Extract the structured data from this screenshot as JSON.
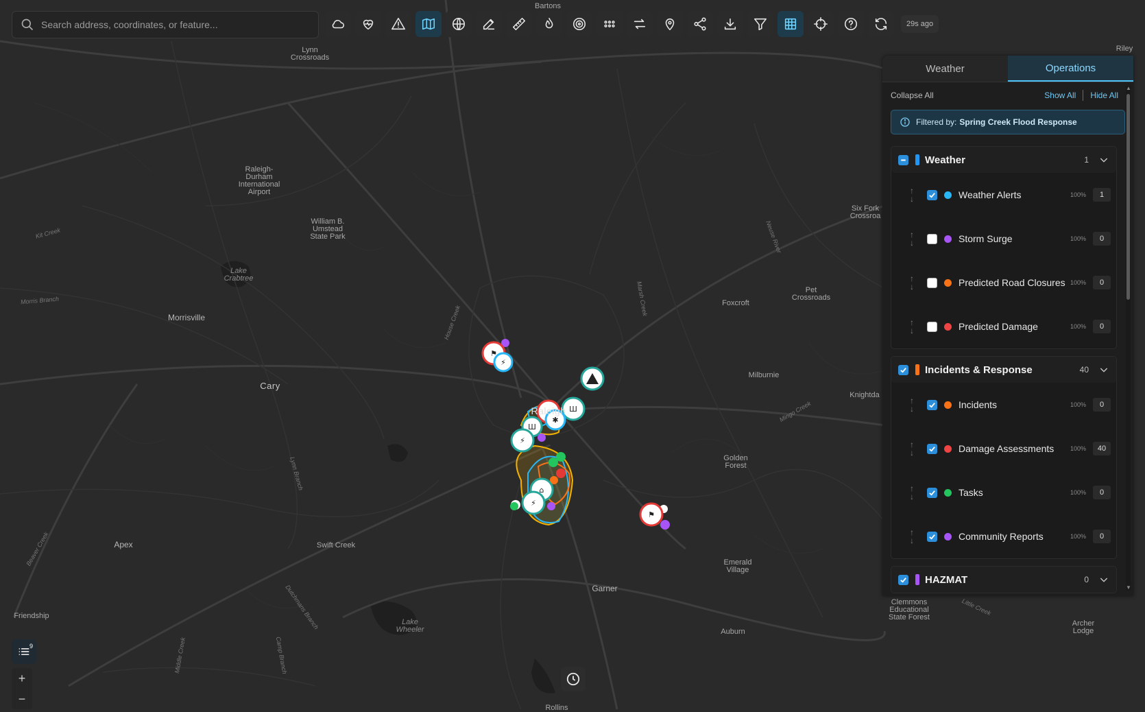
{
  "search": {
    "placeholder": "Search address, coordinates, or feature..."
  },
  "toolbar": {
    "buttons": [
      {
        "name": "cloud-icon",
        "active": false
      },
      {
        "name": "heart-pulse-icon",
        "active": false
      },
      {
        "name": "warning-icon",
        "active": false
      },
      {
        "name": "map-icon",
        "active": true
      },
      {
        "name": "globe-icon",
        "active": false
      },
      {
        "name": "edit-icon",
        "active": false
      },
      {
        "name": "ruler-icon",
        "active": false
      },
      {
        "name": "fire-icon",
        "active": false
      },
      {
        "name": "target-icon",
        "active": false
      },
      {
        "name": "grid-dots-icon",
        "active": false
      },
      {
        "name": "swap-icon",
        "active": false
      },
      {
        "name": "location-pin-icon",
        "active": false
      },
      {
        "name": "share-icon",
        "active": false
      },
      {
        "name": "download-icon",
        "active": false
      },
      {
        "name": "filter-icon",
        "active": false
      },
      {
        "name": "table-icon",
        "active": true
      },
      {
        "name": "crosshair-icon",
        "active": false
      },
      {
        "name": "help-icon",
        "active": false
      },
      {
        "name": "refresh-icon",
        "active": false
      }
    ],
    "updated": "29s ago"
  },
  "places": [
    {
      "name": "Bartons",
      "cls": "place"
    },
    {
      "name": "Lynn\nCrossroads",
      "cls": "place"
    },
    {
      "name": "Riley",
      "cls": "place"
    },
    {
      "name": "Raleigh-\nDurham\nInternational\nAirport",
      "cls": "place"
    },
    {
      "name": "William B.\nUmstead\nState Park",
      "cls": "place"
    },
    {
      "name": "Lake\nCrabtree",
      "cls": "place water"
    },
    {
      "name": "Morrisville",
      "cls": "place big"
    },
    {
      "name": "Cary",
      "cls": "place city"
    },
    {
      "name": "Raleigh",
      "cls": "place city"
    },
    {
      "name": "Foxcroft",
      "cls": "place"
    },
    {
      "name": "Pet\nCrossroads",
      "cls": "place"
    },
    {
      "name": "Six Fork\nCrossroa",
      "cls": "place"
    },
    {
      "name": "Milburnie",
      "cls": "place"
    },
    {
      "name": "Knightda",
      "cls": "place"
    },
    {
      "name": "Golden\nForest",
      "cls": "place"
    },
    {
      "name": "Apex",
      "cls": "place big"
    },
    {
      "name": "Swift Creek",
      "cls": "place"
    },
    {
      "name": "Emerald\nVillage",
      "cls": "place"
    },
    {
      "name": "Garner",
      "cls": "place big"
    },
    {
      "name": "Friendship",
      "cls": "place"
    },
    {
      "name": "Lake\nWheeler",
      "cls": "place water"
    },
    {
      "name": "Auburn",
      "cls": "place"
    },
    {
      "name": "Clemmons\nEducational\nState Forest",
      "cls": "place"
    },
    {
      "name": "Archer\nLodge",
      "cls": "place"
    },
    {
      "name": "Rollins",
      "cls": "place"
    },
    {
      "name": "Kit Creek",
      "cls": "place road"
    },
    {
      "name": "Morris Branch",
      "cls": "place road"
    },
    {
      "name": "Lynn Branch",
      "cls": "place road"
    },
    {
      "name": "Beaver Creek",
      "cls": "place road"
    },
    {
      "name": "Neuse River",
      "cls": "place road"
    },
    {
      "name": "House Creek",
      "cls": "place road"
    },
    {
      "name": "Marsh Creek",
      "cls": "place road"
    },
    {
      "name": "Mingo Creek",
      "cls": "place road"
    },
    {
      "name": "Middle Creek",
      "cls": "place road"
    },
    {
      "name": "Camp Branch",
      "cls": "place road"
    },
    {
      "name": "Dutchmans Branch",
      "cls": "place road"
    },
    {
      "name": "Little Creek",
      "cls": "place road"
    }
  ],
  "panel": {
    "tabs": [
      {
        "label": "Weather",
        "active": false
      },
      {
        "label": "Operations",
        "active": true
      }
    ],
    "collapse_all": "Collapse All",
    "show_all": "Show All",
    "hide_all": "Hide All",
    "filter_prefix": "Filtered by:",
    "filter_value": "Spring Creek Flood Response",
    "groups": [
      {
        "title": "Weather",
        "count": "1",
        "color": "#2196f3",
        "state": "part",
        "layers": [
          {
            "name": "Weather Alerts",
            "color": "#29b6f6",
            "checked": true,
            "pct": "100%",
            "count": "1"
          },
          {
            "name": "Storm Surge",
            "color": "#a855f7",
            "checked": false,
            "pct": "100%",
            "count": "0"
          },
          {
            "name": "Predicted Road Closures",
            "color": "#f97316",
            "checked": false,
            "pct": "100%",
            "count": "0"
          },
          {
            "name": "Predicted Damage",
            "color": "#ef4444",
            "checked": false,
            "pct": "100%",
            "count": "0"
          }
        ]
      },
      {
        "title": "Incidents & Response",
        "count": "40",
        "color": "#f97316",
        "state": "on",
        "layers": [
          {
            "name": "Incidents",
            "color": "#f97316",
            "checked": true,
            "pct": "100%",
            "count": "0"
          },
          {
            "name": "Damage Assessments",
            "color": "#ef4444",
            "checked": true,
            "pct": "100%",
            "count": "40"
          },
          {
            "name": "Tasks",
            "color": "#22c55e",
            "checked": true,
            "pct": "100%",
            "count": "0"
          },
          {
            "name": "Community Reports",
            "color": "#a855f7",
            "checked": true,
            "pct": "100%",
            "count": "0"
          }
        ]
      },
      {
        "title": "HAZMAT",
        "count": "0",
        "color": "#a855f7",
        "state": "on",
        "layers": []
      }
    ]
  },
  "layers_badge": "9",
  "zoom": {
    "in": "+",
    "out": "−"
  }
}
